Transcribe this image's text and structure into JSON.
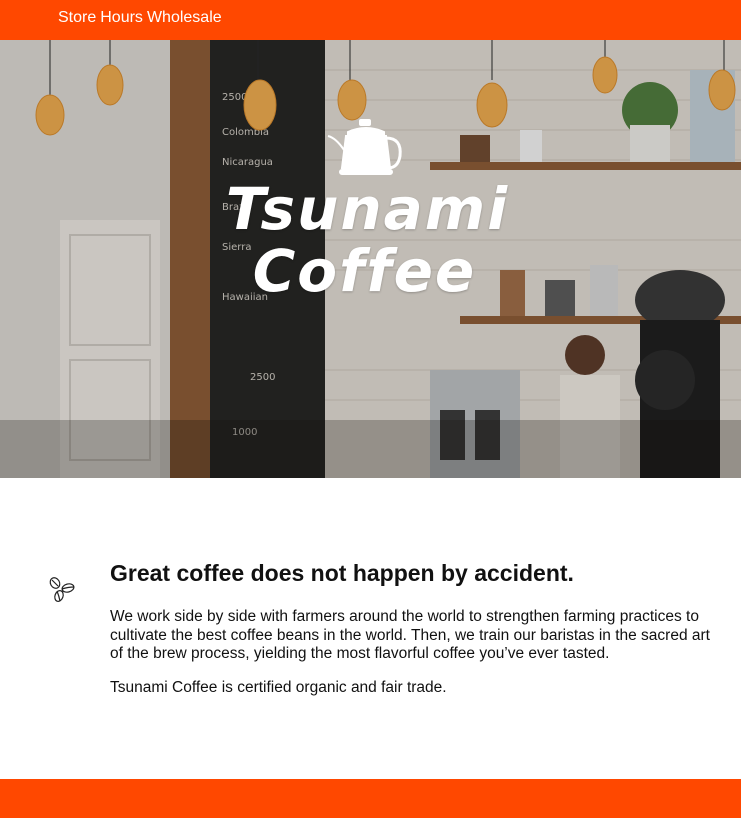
{
  "nav": {
    "items": [
      "Store",
      "Hours",
      "Wholesale"
    ]
  },
  "hero": {
    "brand_line1": "Tsunami",
    "brand_line2": "Coffee"
  },
  "content": {
    "headline": "Great coffee does not happen by accident.",
    "paragraph1": "We work side by side with farmers around the world to strengthen farming practices to cultivate the best coffee beans in the world. Then, we train our baristas in the sacred art of the brew process, yielding the most flavorful coffee you’ve ever tasted.",
    "paragraph2": "Tsunami Coffee is certified organic and fair trade."
  },
  "colors": {
    "accent": "#ff4800",
    "text": "#111111"
  },
  "icons": [
    "kettle-icon",
    "coffee-beans-icon"
  ]
}
